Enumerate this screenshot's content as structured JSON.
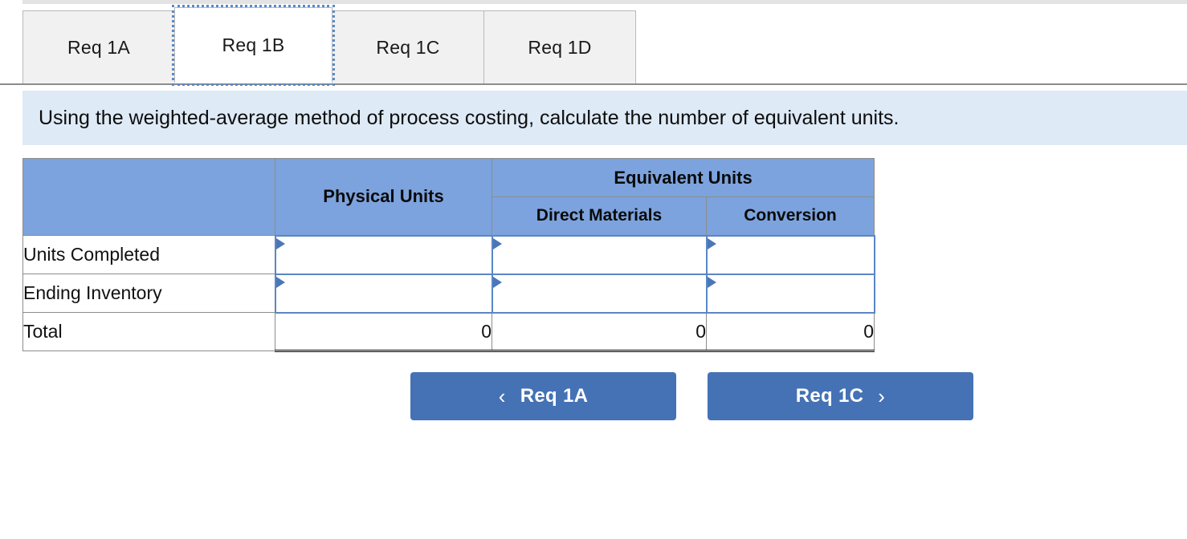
{
  "tabs": [
    {
      "label": "Req 1A",
      "selected": false
    },
    {
      "label": "Req 1B",
      "selected": true
    },
    {
      "label": "Req 1C",
      "selected": false
    },
    {
      "label": "Req 1D",
      "selected": false
    }
  ],
  "instruction": "Using the weighted-average method of process costing, calculate the number of equivalent units.",
  "table": {
    "corner_header": "",
    "col_physical": "Physical Units",
    "group_header": "Equivalent Units",
    "col_direct_materials": "Direct Materials",
    "col_conversion": "Conversion",
    "rows": [
      {
        "label": "Units Completed",
        "physical": "",
        "direct_materials": "",
        "conversion": "",
        "editable": true
      },
      {
        "label": "Ending Inventory",
        "physical": "",
        "direct_materials": "",
        "conversion": "",
        "editable": true
      },
      {
        "label": "Total",
        "physical": "0",
        "direct_materials": "0",
        "conversion": "0",
        "editable": false
      }
    ]
  },
  "nav": {
    "prev_label": "Req 1A",
    "prev_icon": "chevron-left-icon",
    "prev_glyph": "‹",
    "next_label": "Req 1C",
    "next_icon": "chevron-right-icon",
    "next_glyph": "›"
  },
  "colors": {
    "header_blue": "#7CA3DD",
    "banner_blue": "#DEEAF6",
    "button_blue": "#4472B4",
    "input_border": "#5B86C4",
    "tab_inactive": "#F1F1F1",
    "grid_line": "#8C8C8C"
  }
}
